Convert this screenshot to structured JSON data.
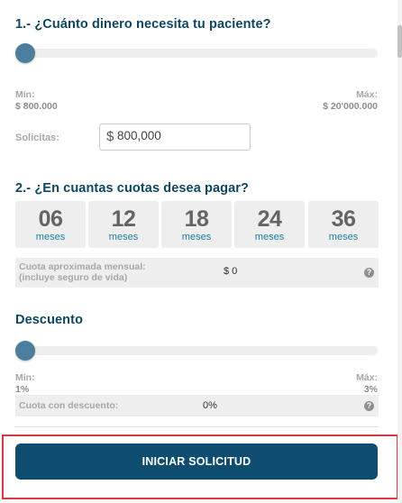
{
  "amount": {
    "title": "1.- ¿Cuánto dinero necesita tu paciente?",
    "slider_fraction": 0.0,
    "min_label": "Mín:",
    "min_value": "$ 800.000",
    "max_label": "Máx:",
    "max_value": "$ 20'000.000",
    "solicitas_label": "Solicitas:",
    "currency_symbol": "$",
    "input_value": "800,000"
  },
  "cuotas": {
    "title": "2.- ¿En cuantas cuotas desea pagar?",
    "options": [
      {
        "number": "06",
        "unit": "meses"
      },
      {
        "number": "12",
        "unit": "meses"
      },
      {
        "number": "18",
        "unit": "meses"
      },
      {
        "number": "24",
        "unit": "meses"
      },
      {
        "number": "36",
        "unit": "meses"
      }
    ],
    "monthly_label_1": "Cuota aproximada mensual:",
    "monthly_label_2": "(incluye seguro de vida)",
    "monthly_value": "$ 0",
    "help_glyph": "?"
  },
  "descuento": {
    "title": "Descuento",
    "slider_fraction": 0.0,
    "min_label": "Mín:",
    "min_value": "1%",
    "max_label": "Máx:",
    "max_value": "3%",
    "discount_label": "Cuota con descuento:",
    "discount_value": "0%",
    "help_glyph": "?"
  },
  "cta": {
    "label": "INICIAR SOLICITUD"
  },
  "colors": {
    "heading": "#0f4763",
    "knob": "#4c7d9c",
    "button": "#0e4d6f",
    "highlight_frame": "#d63a3a",
    "cuota_unit": "#1d7fa3"
  }
}
